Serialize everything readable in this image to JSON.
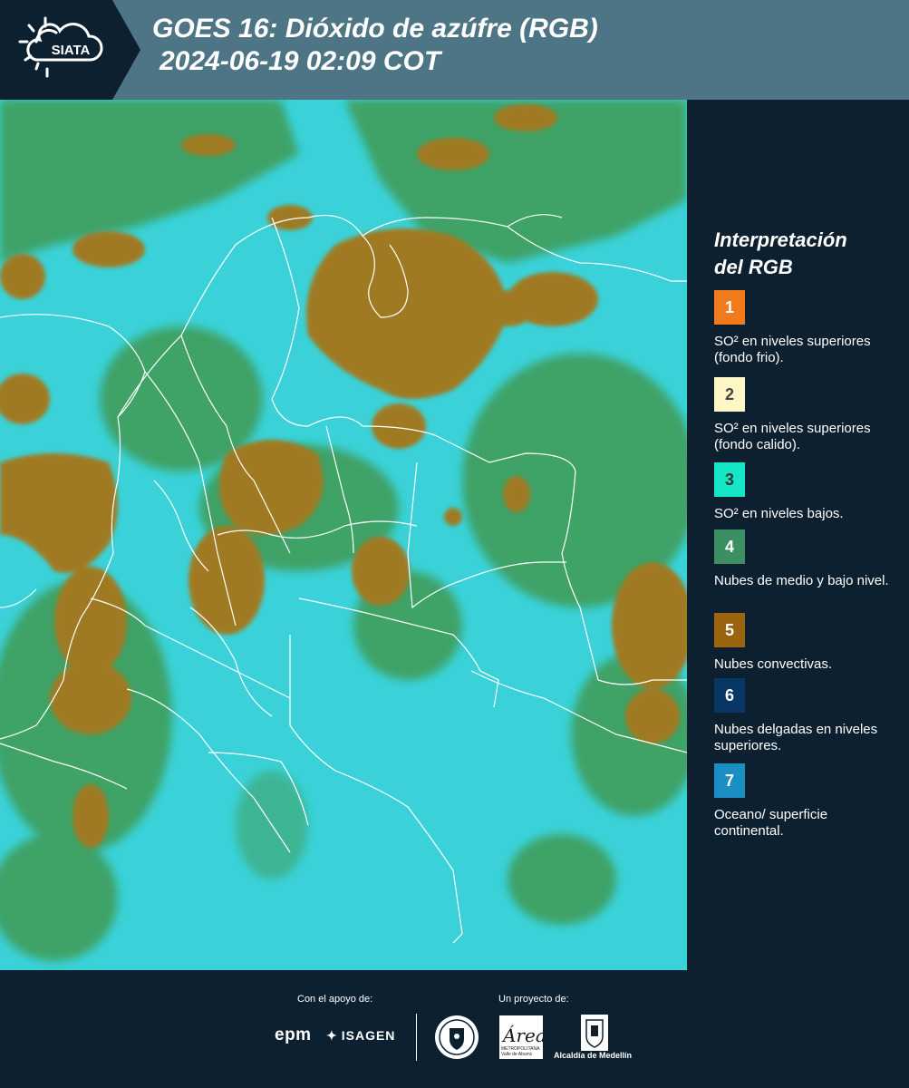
{
  "header": {
    "logo_text": "SIATA",
    "title_line1": "GOES 16: Dióxido de azúfre (RGB)",
    "title_line2": "2024-06-19 02:09 COT"
  },
  "legend": {
    "title_line1": "Interpretación",
    "title_line2": "del RGB",
    "items": [
      {
        "num": "1",
        "color": "#f07a1c",
        "text_color": "#ffffff",
        "text": "SO² en niveles superiores (fondo frio)."
      },
      {
        "num": "2",
        "color": "#fff6c6",
        "text_color": "#444444",
        "text": "SO² en niveles superiores (fondo calido)."
      },
      {
        "num": "3",
        "color": "#15e6c8",
        "text_color": "#333333",
        "text": "SO² en niveles bajos."
      },
      {
        "num": "4",
        "color": "#3b8f63",
        "text_color": "#ffffff",
        "text": "Nubes de medio y bajo nivel."
      },
      {
        "num": "5",
        "color": "#9a6410",
        "text_color": "#ffffff",
        "text": "Nubes convectivas."
      },
      {
        "num": "6",
        "color": "#083766",
        "text_color": "#ffffff",
        "text": "Nubes delgadas en niveles superiores."
      },
      {
        "num": "7",
        "color": "#1b8fc4",
        "text_color": "#ffffff",
        "text": "Oceano/ superficie continental."
      }
    ]
  },
  "footer": {
    "support_label": "Con el apoyo de:",
    "project_label": "Un proyecto de:",
    "sponsor1": "epm",
    "sponsor2": "ISAGEN",
    "partner_area": "Área",
    "partner_area_sub": "METROPOLITANA Valle de Aburrá",
    "partner_alcaldia": "Alcaldía de Medellín"
  },
  "map_colors": {
    "background": "#3ad2d8",
    "low_cloud": "#3f9a52",
    "convective": "#a07a22",
    "border": "#ffffff"
  }
}
